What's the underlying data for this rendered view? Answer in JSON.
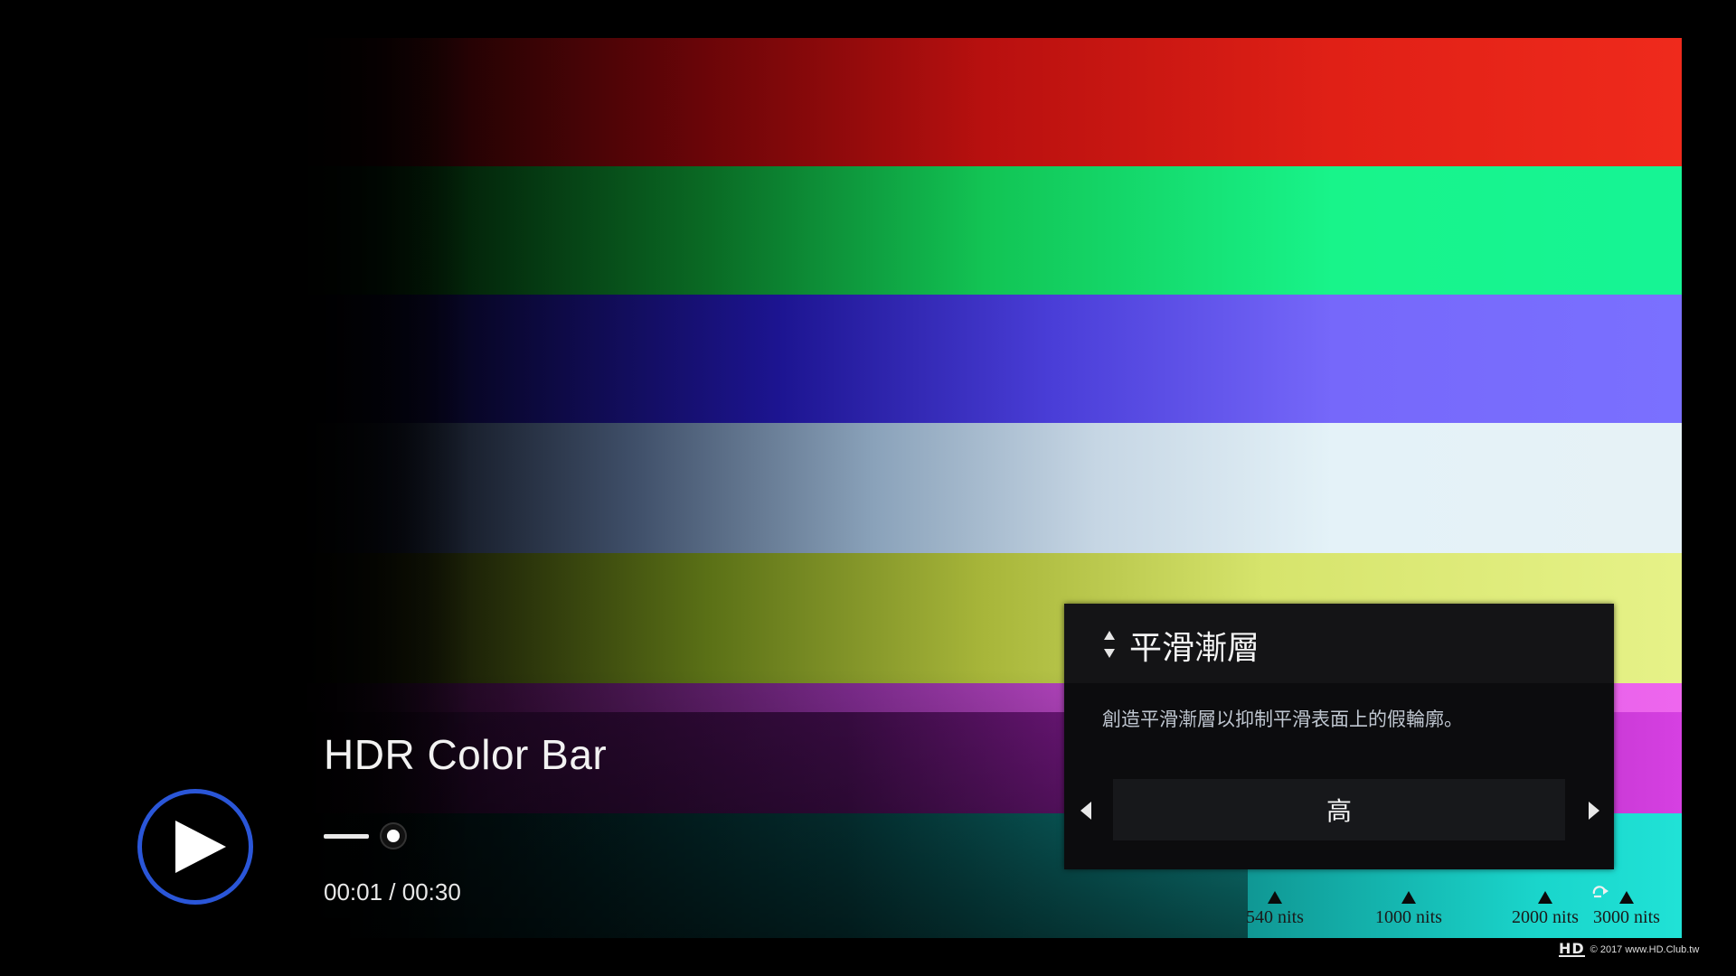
{
  "player": {
    "title": "HDR Color Bar",
    "current_time": "00:01",
    "duration": "00:30",
    "time_display": "00:01 / 00:30",
    "play_icon": "play-icon",
    "accent_color": "#2a56d8"
  },
  "settings_panel": {
    "title": "平滑漸層",
    "description": "創造平滑漸層以抑制平滑表面上的假輪廓。",
    "selected_value": "高",
    "header_icon": "up-down-arrows-icon",
    "prev_icon": "arrow-left-icon",
    "next_icon": "arrow-right-icon"
  },
  "color_bars": [
    {
      "name": "red",
      "color": "#ef2a1c"
    },
    {
      "name": "green",
      "color": "#16f495"
    },
    {
      "name": "blue",
      "color": "#7a70ff"
    },
    {
      "name": "white",
      "color": "#e6f2f6"
    },
    {
      "name": "yellow",
      "color": "#e6f288"
    },
    {
      "name": "magenta",
      "color": "#d640e2"
    },
    {
      "name": "cyan",
      "color": "#20e2d6"
    }
  ],
  "nits_markers": [
    {
      "label": "540 nits"
    },
    {
      "label": "1000 nits"
    },
    {
      "label": "2000 nits"
    },
    {
      "label": "3000 nits"
    }
  ],
  "watermark": {
    "logo": "HD",
    "text": "© 2017 www.HD.Club.tw"
  }
}
